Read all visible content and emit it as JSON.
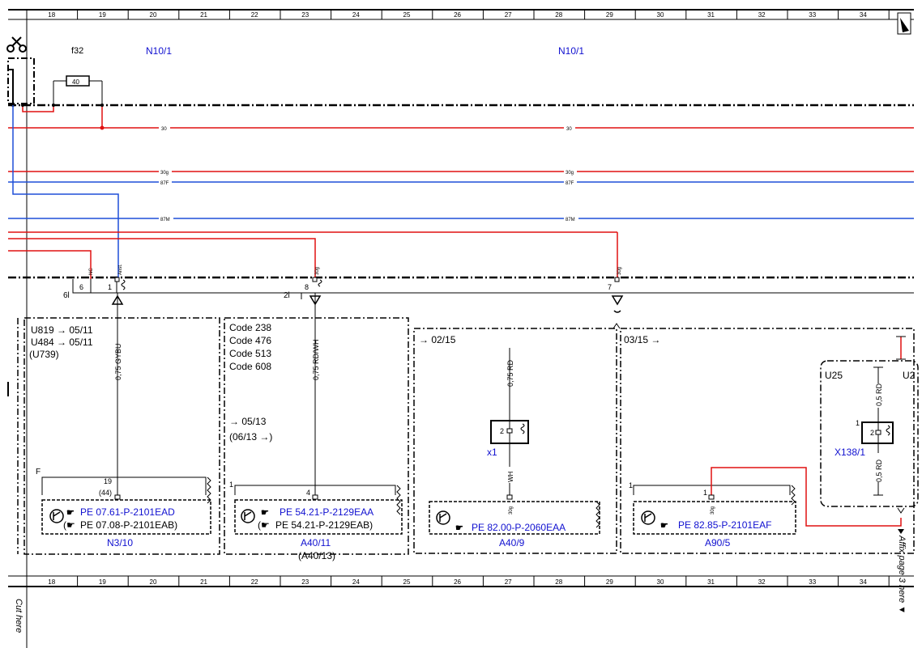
{
  "colors": {
    "wire_red": "#e01010",
    "wire_blue": "#1f4fd8",
    "text_blue": "#1010d0",
    "line": "#000000"
  },
  "ruler": {
    "numbers": [
      "18",
      "19",
      "20",
      "21",
      "22",
      "23",
      "24",
      "25",
      "26",
      "27",
      "28",
      "29",
      "30",
      "31",
      "32",
      "33",
      "34"
    ]
  },
  "labels": {
    "fuse_ref": "f32",
    "fuse_value": "40",
    "n10_left": "N10/1",
    "n10_right": "N10/1"
  },
  "bus": {
    "b30_left": "30",
    "b30_right": "30",
    "b30g_left": "30g",
    "b30g_right": "30g",
    "b87f_left": "87F",
    "b87f_right": "87F",
    "b87m_left": "87M",
    "b87m_right": "87M"
  },
  "connectors": {
    "pin_nc": "NC",
    "pin_anst": "Anst.",
    "pin_30g_a": "30g",
    "pin_30g_b": "30g",
    "sixl": "6l",
    "twol": "2l",
    "num6": "6",
    "num1": "1",
    "num8": "8",
    "num7": "7"
  },
  "block1": {
    "line1": "U819 → 05/11",
    "line2": "U484 → 05/11",
    "line3": "(U739)",
    "wire": "0,75 GYBU",
    "f": "F",
    "pin19": "19",
    "pin44": "(44)",
    "ref1": "PE 07.61-P-2101EAD",
    "ref2": "PE 07.08-P-2101EAB)",
    "name": "N3/10"
  },
  "block2": {
    "code1": "Code 238",
    "code2": "Code 476",
    "code3": "Code 513",
    "code4": "Code 608",
    "ref_a": "→ 05/13",
    "ref_b": "(06/13 →)",
    "wire": "0,75 RD/WH",
    "one": "1",
    "pin4": "4",
    "ref1": "PE 54.21-P-2129EAA",
    "ref2": "PE 54.21-P-2129EAB)",
    "name": "A40/11",
    "name2": "(A40/13)"
  },
  "block3": {
    "ref": "→ 02/15",
    "wire_rd": "0,75 RD",
    "wire_wh": "WH",
    "conn": "x1",
    "pin2": "2",
    "pin30g": "30g",
    "pe": "PE 82.00-P-2060EAA",
    "name": "A40/9"
  },
  "block4": {
    "ref": "03/15 →",
    "one_a": "1",
    "one_b": "1",
    "pin30g": "30g",
    "pe": "PE 82.85-P-2101EAF",
    "name": "A90/5"
  },
  "block5": {
    "u25": "U25",
    "u2": "U2",
    "wire1": "0,5 RD",
    "wire2": "0,5 RD",
    "pin1": "1",
    "pin2": "2",
    "name": "X138/1"
  },
  "side": {
    "cut_here": "Cut here",
    "affix": "Affix page 3 here ▼"
  }
}
